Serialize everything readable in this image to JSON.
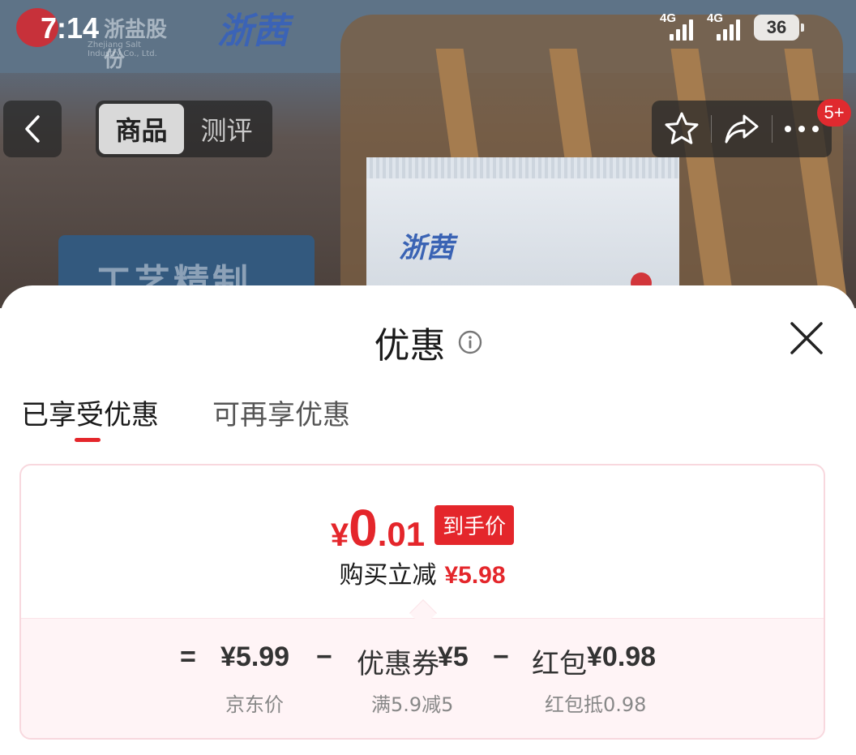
{
  "status_bar": {
    "time": "7:14",
    "network_1": "4G",
    "network_2": "4G",
    "battery": "36"
  },
  "background": {
    "brand_logo_left": "浙盐股份",
    "brand_logo_left_sub": "Zhejiang Salt Industry Co., Ltd.",
    "brand_logo_top": "浙茜",
    "package_logo": "浙茜",
    "board_text": "工艺精制"
  },
  "nav": {
    "tabs": [
      {
        "label": "商品",
        "active": true
      },
      {
        "label": "测评",
        "active": false
      }
    ],
    "badge": "5+"
  },
  "sheet": {
    "title": "优惠",
    "tabs": [
      {
        "label": "已享受优惠",
        "active": true
      },
      {
        "label": "可再享优惠",
        "active": false
      }
    ],
    "price": {
      "currency": "¥",
      "integer": "0",
      "decimal": ".01",
      "tag": "到手价"
    },
    "saving": {
      "label": "购买立减",
      "value": "¥5.98"
    },
    "breakdown": {
      "equals": "=",
      "items": [
        {
          "value": "¥5.99",
          "sub": "京东价"
        },
        {
          "op": "−",
          "label": "优惠券",
          "value": "¥5",
          "sub": "满5.9减5"
        },
        {
          "op": "−",
          "label": "红包",
          "value": "¥0.98",
          "sub": "红包抵0.98"
        }
      ]
    }
  },
  "colors": {
    "accent": "#e4262b",
    "card_border": "#f8d8de",
    "breakdown_bg": "#fff4f6"
  }
}
